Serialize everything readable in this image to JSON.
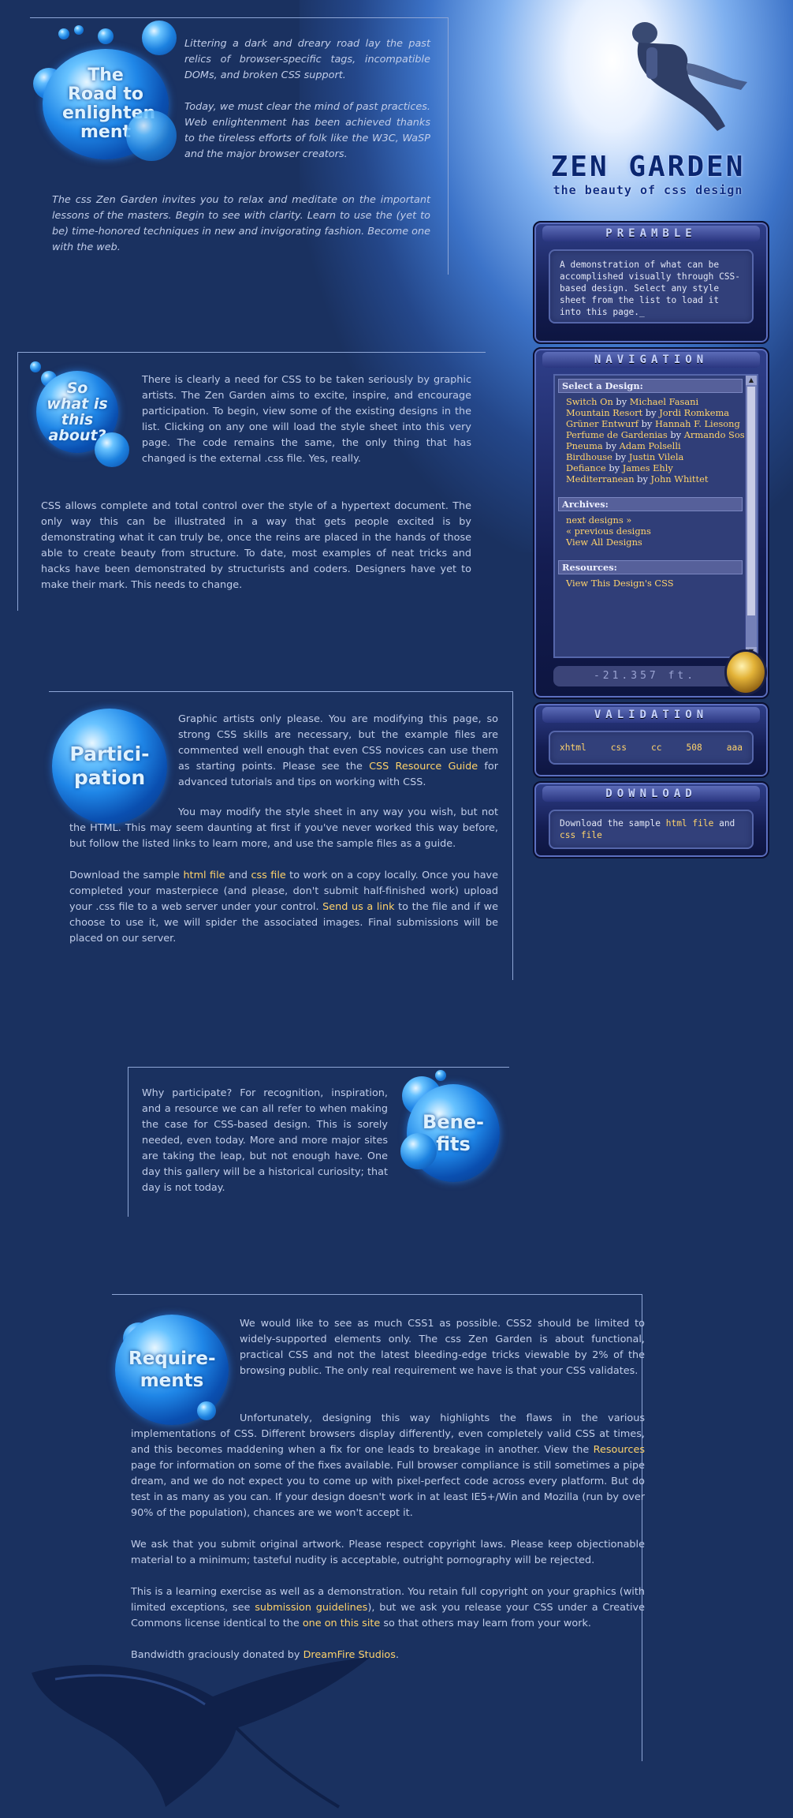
{
  "colors": {
    "background": "#1a3160",
    "text": "#c1cde9",
    "link": "#ffd36b",
    "panel": "#32407a"
  },
  "intro": {
    "bubble_text": "The Road to enlighten ment",
    "p1": "Littering a dark and dreary road lay the past relics of browser-specific tags, incompatible DOMs, and broken CSS support.",
    "p2": "Today, we must clear the mind of past practices. Web enlightenment has been achieved thanks to the tireless efforts of folk like the W3C, WaSP and the major browser creators.",
    "p3": "The css Zen Garden invites you to relax and meditate on the important lessons of the masters. Begin to see with clarity. Learn to use the (yet to be) time-honored techniques in new and invigorating fashion. Become one with the web."
  },
  "explanation": {
    "bubble_text": "So what is this about?",
    "p1": "There is clearly a need for CSS to be taken seriously by graphic artists. The Zen Garden aims to excite, inspire, and encourage participation. To begin, view some of the existing designs in the list. Clicking on any one will load the style sheet into this very page. The code remains the same, the only thing that has changed is the external .css file. Yes, really.",
    "p2": "CSS allows complete and total control over the style of a hypertext document. The only way this can be illustrated in a way that gets people excited is by demonstrating what it can truly be, once the reins are placed in the hands of those able to create beauty from structure. To date, most examples of neat tricks and hacks have been demonstrated by structurists and coders. Designers have yet to make their mark. This needs to change."
  },
  "participation": {
    "bubble_text": "Partici- pation",
    "p1_before": "Graphic artists only please. You are modifying this page, so strong CSS skills are necessary, but the example files are commented well enough that even CSS novices can use them as starting points. Please see the ",
    "p1_link": "CSS Resource Guide",
    "p1_after": " for advanced tutorials and tips on working with CSS.",
    "p2": "You may modify the style sheet in any way you wish, but not the HTML. This may seem daunting at first if you've never worked this way before, but follow the listed links to learn more, and use the sample files as a guide.",
    "p3_a": "Download the sample ",
    "p3_link1": "html file",
    "p3_b": " and ",
    "p3_link2": "css file",
    "p3_c": " to work on a copy locally. Once you have completed your masterpiece (and please, don't submit half-finished work) upload your .css file to a web server under your control. ",
    "p3_link3": "Send us a link",
    "p3_d": " to the file and if we choose to use it, we will spider the associated images. Final submissions will be placed on our server."
  },
  "benefits": {
    "bubble_text": "Bene- fits",
    "p1": "Why participate? For recognition, inspiration, and a resource we can all refer to when making the case for CSS-based design. This is sorely needed, even today. More and more major sites are taking the leap, but not enough have. One day this gallery will be a historical curiosity; that day is not today."
  },
  "requirements": {
    "bubble_text": "Require- ments",
    "p1": "We would like to see as much CSS1 as possible. CSS2 should be limited to widely-supported elements only. The css Zen Garden is about functional, practical CSS and not the latest bleeding-edge tricks viewable by 2% of the browsing public. The only real requirement we have is that your CSS validates.",
    "p2_a": "Unfortunately, designing this way highlights the flaws in the various implementations of CSS. Different browsers display differently, even completely valid CSS at times, and this becomes maddening when a fix for one leads to breakage in another. View the ",
    "p2_link": "Resources",
    "p2_b": " page for information on some of the fixes available. Full browser compliance is still sometimes a pipe dream, and we do not expect you to come up with pixel-perfect code across every platform. But do test in as many as you can. If your design doesn't work in at least IE5+/Win and Mozilla (run by over 90% of the population), chances are we won't accept it.",
    "p3": "We ask that you submit original artwork. Please respect copyright laws. Please keep objectionable material to a minimum; tasteful nudity is acceptable, outright pornography will be rejected.",
    "p4_a": "This is a learning exercise as well as a demonstration. You retain full copyright on your graphics (with limited exceptions, see ",
    "p4_link1": "submission guidelines",
    "p4_b": "), but we ask you release your CSS under a Creative Commons license identical to the ",
    "p4_link2": "one on this site",
    "p4_c": " so that others may learn from your work.",
    "footer_a": "Bandwidth graciously donated by ",
    "footer_link": "DreamFire Studios",
    "footer_b": "."
  },
  "logo": {
    "title": "ZEN GARDEN",
    "subtitle": "the beauty of css design"
  },
  "preamble": {
    "heading": "PREAMBLE",
    "text": "A demonstration of what can be accomplished visually through CSS-based design. Select any style sheet from the list to load it into this page._"
  },
  "navigation": {
    "heading": "NAVIGATION",
    "select_header": "Select a Design:",
    "designs": [
      {
        "name": "Switch On",
        "by": "by",
        "author": "Michael Fasani"
      },
      {
        "name": "Mountain Resort",
        "by": "by",
        "author": "Jordi Romkema"
      },
      {
        "name": "Grüner Entwurf",
        "by": "by",
        "author": "Hannah F. Liesong"
      },
      {
        "name": "Perfume de Gardenias",
        "by": "by",
        "author": "Armando Sosa"
      },
      {
        "name": "Pneuma",
        "by": "by",
        "author": "Adam Polselli"
      },
      {
        "name": "Birdhouse",
        "by": "by",
        "author": "Justin Vilela"
      },
      {
        "name": "Defiance",
        "by": "by",
        "author": "James Ehly"
      },
      {
        "name": "Mediterranean",
        "by": "by",
        "author": "John Whittet"
      }
    ],
    "archives_header": "Archives:",
    "archives": [
      "next designs »",
      "« previous designs",
      "View All Designs"
    ],
    "resources_header": "Resources:",
    "resources": [
      "View This Design's CSS"
    ],
    "depth": "-21.357 ft."
  },
  "validation": {
    "heading": "VALIDATION",
    "links": [
      "xhtml",
      "css",
      "cc",
      "508",
      "aaa"
    ]
  },
  "download": {
    "heading": "DOWNLOAD",
    "text_a": "Download the sample ",
    "link1": "html file",
    "text_b": " and ",
    "link2": "css file"
  }
}
